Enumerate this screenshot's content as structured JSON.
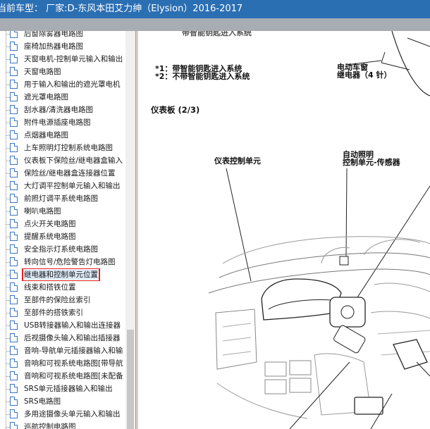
{
  "window": {
    "title": "当前车型： 厂家:D-东风本田艾力绅（Elysion）2016-2017"
  },
  "tree": {
    "items": [
      {
        "label": "后窗除雾器电路图"
      },
      {
        "label": "座椅加热器电路图"
      },
      {
        "label": "天窗电机-控制单元输入和输出"
      },
      {
        "label": "天窗电路图"
      },
      {
        "label": "用于输入和输出的遮光罩电机"
      },
      {
        "label": "遮光罩电路图"
      },
      {
        "label": "刮水器/清洗器电路图"
      },
      {
        "label": "附件电源插座电路图"
      },
      {
        "label": "点烟器电路图"
      },
      {
        "label": "上车照明灯控制系统电路图"
      },
      {
        "label": "仪表板下保险丝/继电器盒输入"
      },
      {
        "label": "保险丝/继电器盒连接器位置"
      },
      {
        "label": "大灯调平控制单元输入和输出"
      },
      {
        "label": "前照灯调平系统电路图"
      },
      {
        "label": "喇叭电路图"
      },
      {
        "label": "点火开关电路图"
      },
      {
        "label": "提醒系统电路图"
      },
      {
        "label": "安全指示灯系统电路图"
      },
      {
        "label": "转向信号/危险警告灯电路图"
      },
      {
        "label": "继电器和控制单元位置",
        "selected": true
      },
      {
        "label": "线束和搭铁位置"
      },
      {
        "label": "至部件的保险丝索引"
      },
      {
        "label": "至部件的搭铁索引"
      },
      {
        "label": "USB转接器输入和输出连接器"
      },
      {
        "label": "后视摄像头输入和输出插接器"
      },
      {
        "label": "音响-导航单元插接器输入和输"
      },
      {
        "label": "音响和可视系统电路图[带导航"
      },
      {
        "label": "音响和可视系统电路图[未配备"
      },
      {
        "label": "SRS单元插接器输入和输出"
      },
      {
        "label": "SRS电路图"
      },
      {
        "label": "多用途摄像头单元输入和输出"
      },
      {
        "label": "巡航控制电路图"
      }
    ]
  },
  "diagram": {
    "top_cut_text": "带智能钥匙进入系统",
    "note1": "*1：带智能钥匙进入系统",
    "note2": "*2：不带智能钥匙进入系统",
    "relay_label_1": "电动车窗",
    "relay_label_2": "继电器（4 针）",
    "section_title": "仪表板 (2/3)",
    "gauge_label": "仪表控制单元",
    "sensor_label_1": "自动照明",
    "sensor_label_2": "控制单元-传感器"
  }
}
